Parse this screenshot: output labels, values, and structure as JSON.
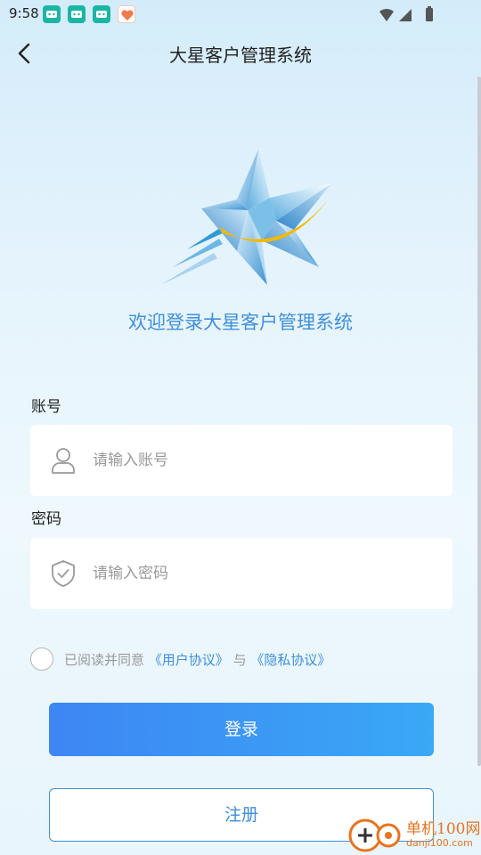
{
  "status_bar": {
    "time": "9:58"
  },
  "nav": {
    "title": "大星客户管理系统"
  },
  "welcome_text": "欢迎登录大星客户管理系统",
  "form": {
    "account_label": "账号",
    "account_placeholder": "请输入账号",
    "account_value": "",
    "password_label": "密码",
    "password_placeholder": "请输入密码",
    "password_value": ""
  },
  "agreement": {
    "checked": false,
    "prefix": "已阅读并同意",
    "user_agreement": "《用户协议》",
    "connector": "与",
    "privacy_agreement": "《隐私协议》"
  },
  "buttons": {
    "login": "登录",
    "register": "注册"
  },
  "watermark": {
    "line1": "单机100网",
    "line2": "danji100.com"
  },
  "colors": {
    "accent": "#3f8fdb",
    "button_start": "#3d86f4",
    "button_end": "#3aa8f5",
    "logo_star": "#5aaee0",
    "logo_swoosh": "#f5b800"
  }
}
